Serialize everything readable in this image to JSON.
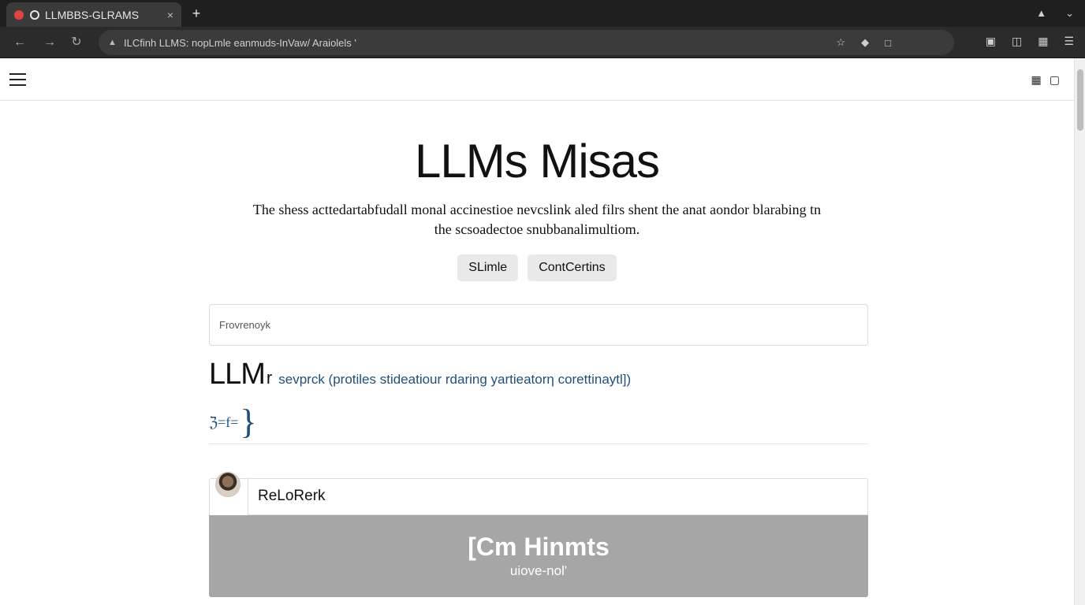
{
  "browser": {
    "tab_title": "LLMBBS-GLRAMS",
    "tab_close": "×",
    "new_tab": "+",
    "address": "ILCfinh LLMS:  nopLmle eanmuds-InVaw/  Araiolels '"
  },
  "site": {
    "title": "LLMs Misas",
    "subtitle": "The shess acttedartabfudall monal accinestioe nevcslink aled filrs shent the anat aondor blarabing tn the scsoadectoe snubbanalimultiom.",
    "buttons": [
      "SLimle",
      "ContCertins"
    ],
    "search_placeholder": "Frovrenoyk",
    "heading_big": "LLM",
    "heading_small": "r",
    "heading_link": "sevprck (protiles stideatiour rdaring yartieatorη corettinaytl])",
    "formula": "ℨ=f=",
    "formula_brace": "}",
    "card_input_value": "ReLoRerk",
    "banner_title": "[Cm Hinmts",
    "banner_sub": "uiove-nol'"
  },
  "icons": {
    "back": "back-arrow-icon",
    "forward": "forward-arrow-icon",
    "reload": "reload-icon",
    "menu": "hamburger-menu-icon"
  }
}
